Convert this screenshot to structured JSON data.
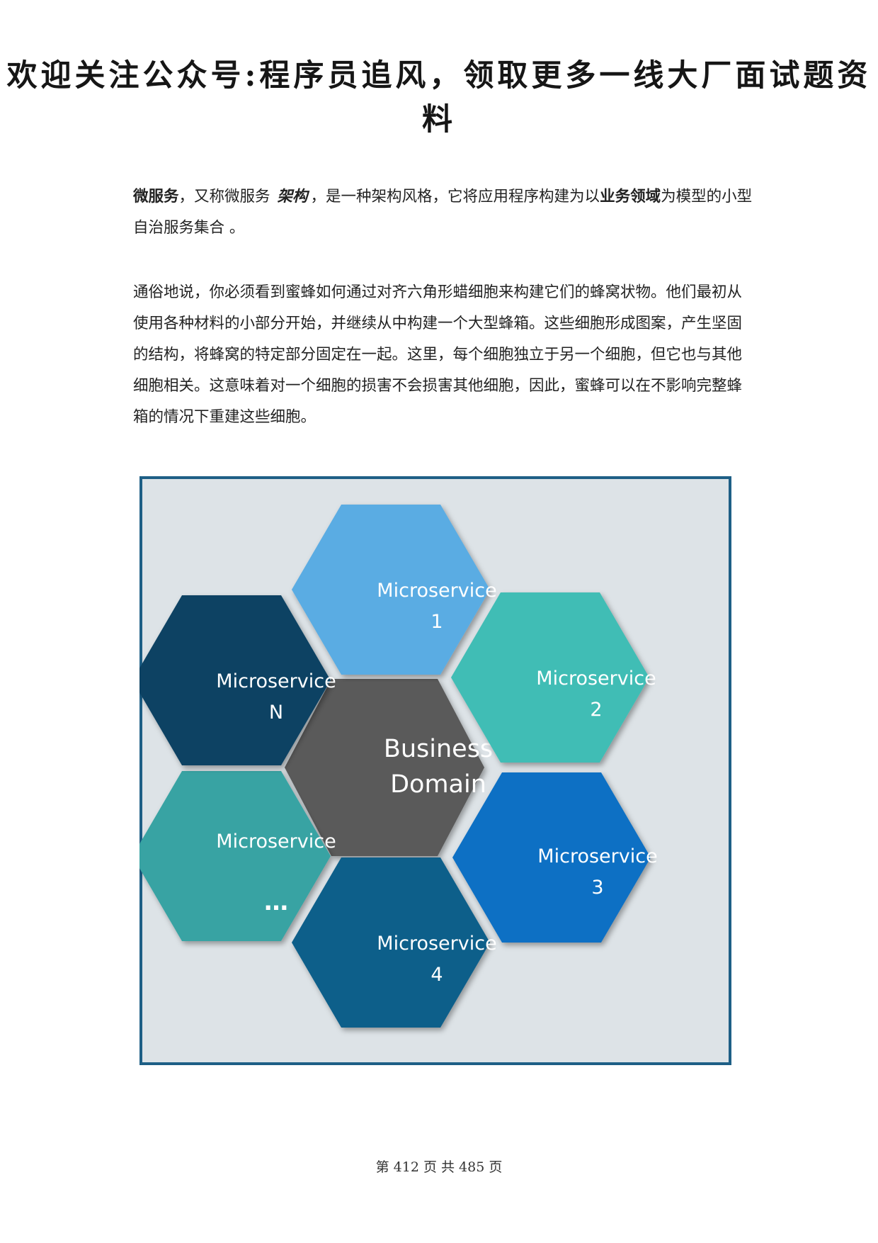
{
  "header": {
    "banner": "欢迎关注公众号:程序员追风，领取更多一线大厂面试题资料"
  },
  "paragraph1": {
    "term": "微服务",
    "part1": "，又称微服务",
    "emph": "架构",
    "part2": "，是一种架构风格，它将应用程序构建为以",
    "domain": "业务领域",
    "part3": "为模型的小型自治服务集合 。"
  },
  "paragraph2": {
    "text": "通俗地说，你必须看到蜜蜂如何通过对齐六角形蜡细胞来构建它们的蜂窝状物。他们最初从使用各种材料的小部分开始，并继续从中构建一个大型蜂箱。这些细胞形成图案，产生坚固的结构，将蜂窝的特定部分固定在一起。这里，每个细胞独立于另一个细胞，但它也与其他细胞相关。这意味着对一个细胞的损害不会损害其他细胞，因此，蜜蜂可以在不影响完整蜂箱的情况下重建这些细胞。"
  },
  "diagram": {
    "center": {
      "line1": "Business",
      "line2": "Domain"
    },
    "hex1": {
      "line1": "Microservice",
      "line2": "1"
    },
    "hex2": {
      "line1": "Microservice",
      "line2": "2"
    },
    "hex3": {
      "line1": "Microservice",
      "line2": "3"
    },
    "hex4": {
      "line1": "Microservice",
      "line2": "4"
    },
    "hexEllipsis": {
      "line1": "Microservice",
      "line2": "…"
    },
    "hexN": {
      "line1": "Microservice",
      "line2": "N"
    },
    "colors": {
      "frame_border": "#1e5f86",
      "frame_fill": "#dde3e7",
      "center": "#5a5a5a",
      "hex1": "#5aace3",
      "hex2": "#40bdb5",
      "hex3": "#0a6fc4",
      "hex4": "#0b5f8a",
      "hexEllipsis": "#37a3a3",
      "hexN": "#0c4263"
    }
  },
  "footer": {
    "page_label": "第 412 页 共 485 页"
  }
}
